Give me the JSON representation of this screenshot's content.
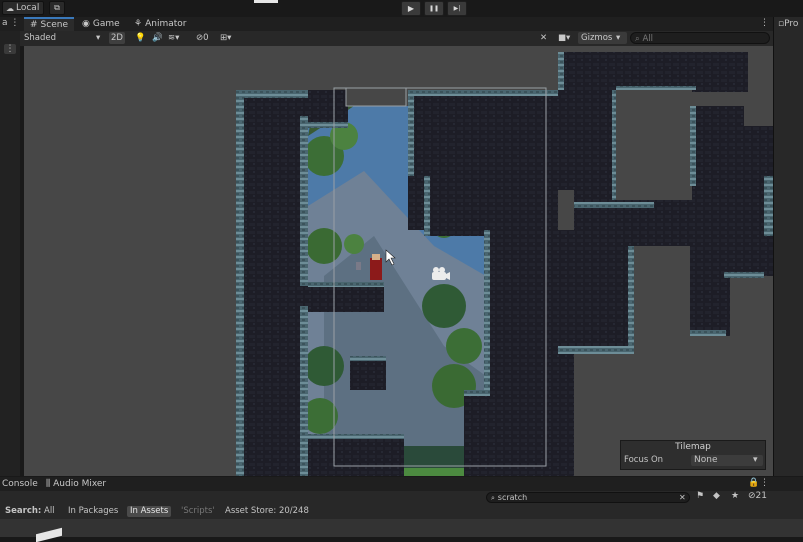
{
  "topbar": {
    "account_label": "Local",
    "play_icon": "▶",
    "pause_icon": "❚❚",
    "step_icon": "▶|"
  },
  "scene_window": {
    "tabs": [
      {
        "label": "Scene"
      },
      {
        "label": "Game"
      },
      {
        "label": "Animator"
      }
    ],
    "menu_dots": "⋮",
    "toolbar": {
      "shading_mode": "Shaded",
      "mode_2d": "2D",
      "hidden_count": "0",
      "gizmos_label": "Gizmos",
      "search_placeholder": "All"
    }
  },
  "right_panel": {
    "title": "Pro"
  },
  "tilemap_overlay": {
    "title": "Tilemap",
    "focus_label": "Focus On",
    "focus_value": "None"
  },
  "bottom_panel": {
    "tabs": [
      {
        "label": "Console"
      },
      {
        "label": "Audio Mixer"
      }
    ],
    "search_value": "scratch",
    "visibility_count": "21",
    "search_label": "Search:",
    "filters": [
      {
        "label": "All"
      },
      {
        "label": "In Packages"
      },
      {
        "label": "In Assets"
      },
      {
        "label": "'Scripts'"
      },
      {
        "label": "Asset Store: 20/248"
      }
    ]
  },
  "colors": {
    "accent": "#3a79bb",
    "viewport_bg": "#474747",
    "tile_dark": "#1c1c24",
    "tile_edge": "#4d6670",
    "sky": "#4d7aa8"
  }
}
